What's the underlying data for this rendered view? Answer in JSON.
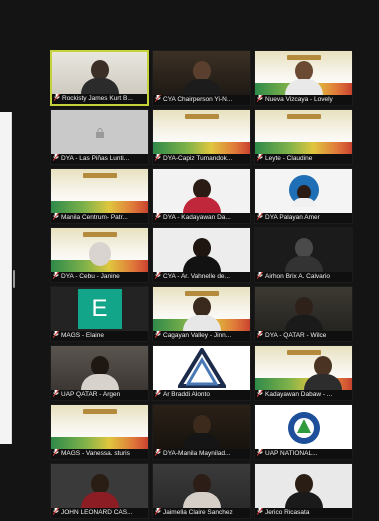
{
  "participants": [
    {
      "label": "Rockisty James Kurt B..."
    },
    {
      "label": "CYA Chairperson Yi-N..."
    },
    {
      "label": "Nueva Vizcaya - Lovely"
    },
    {
      "label": "DYA - Las Piñas Lunti..."
    },
    {
      "label": "DYA-Capiz Tumandok..."
    },
    {
      "label": "Leyte - Claudine"
    },
    {
      "label": "Manila Centrum- Patr..."
    },
    {
      "label": "DYA - Kadayawan Da..."
    },
    {
      "label": "DYA Palayan Amer"
    },
    {
      "label": "DYA - Cebu - Janine"
    },
    {
      "label": "CYA - Ar. Vahnelle de..."
    },
    {
      "label": "Airhon Brix A. Calvario"
    },
    {
      "label": "MAGS - Elaine"
    },
    {
      "label": "Cagayan Valley - Jinn..."
    },
    {
      "label": "DYA - QATAR - Wilce"
    },
    {
      "label": "UAP QATAR - Argen"
    },
    {
      "label": "Ar Braddi Alonto"
    },
    {
      "label": "Kadayawan Dabaw - ..."
    },
    {
      "label": "MAGS - Vanessa. sturis"
    },
    {
      "label": "DYA-Manila Maynilad..."
    },
    {
      "label": "UAP NATIONAL..."
    },
    {
      "label": "JOHN LEONARD CAS..."
    },
    {
      "label": "Jaimella Claire Sanchez"
    },
    {
      "label": "Jerico Ricasata"
    }
  ],
  "tile_letter": "E",
  "colors": {
    "background": "#141414",
    "active_speaker_border": "#c4d33a",
    "mic_muted": "#e0403a"
  }
}
